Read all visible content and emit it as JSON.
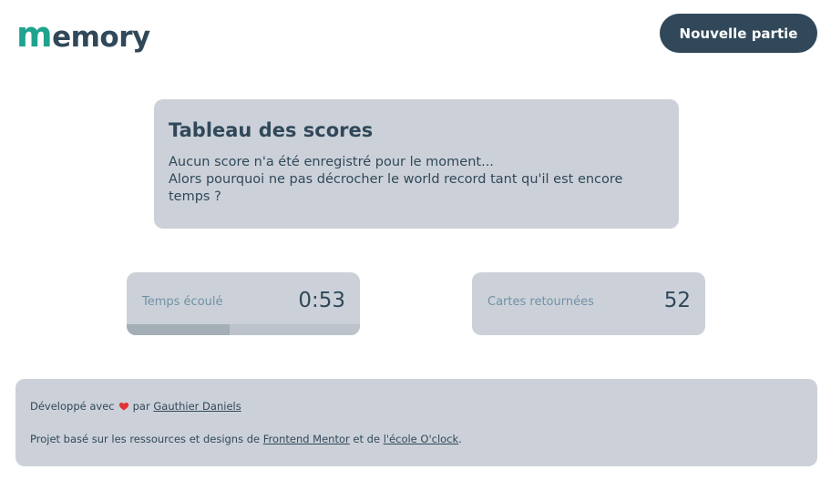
{
  "header": {
    "logo_first": "m",
    "logo_rest": "emory",
    "new_game_label": "Nouvelle partie"
  },
  "scoreboard": {
    "title": "Tableau des scores",
    "line1": "Aucun score n'a été enregistré pour le moment...",
    "line2": "Alors pourquoi ne pas décrocher le world record tant qu'il est encore temps ?"
  },
  "stats": {
    "time_label": "Temps écoulé",
    "time_value": "0:53",
    "time_progress": 0.44,
    "cards_label": "Cartes retournées",
    "cards_value": "52"
  },
  "footer": {
    "line1_prefix": "Développé avec",
    "line1_mid": "par",
    "author_link": "Gauthier Daniels",
    "line2_prefix": "Projet basé sur les ressources et designs de",
    "link1": "Frontend Mentor",
    "line2_mid": "et de",
    "link2": "l'école O'clock",
    "line2_suffix": "."
  },
  "colors": {
    "accent": "#1fa38e",
    "dark": "#304859",
    "panel": "#ccd1d9",
    "heart": "#e03333"
  }
}
